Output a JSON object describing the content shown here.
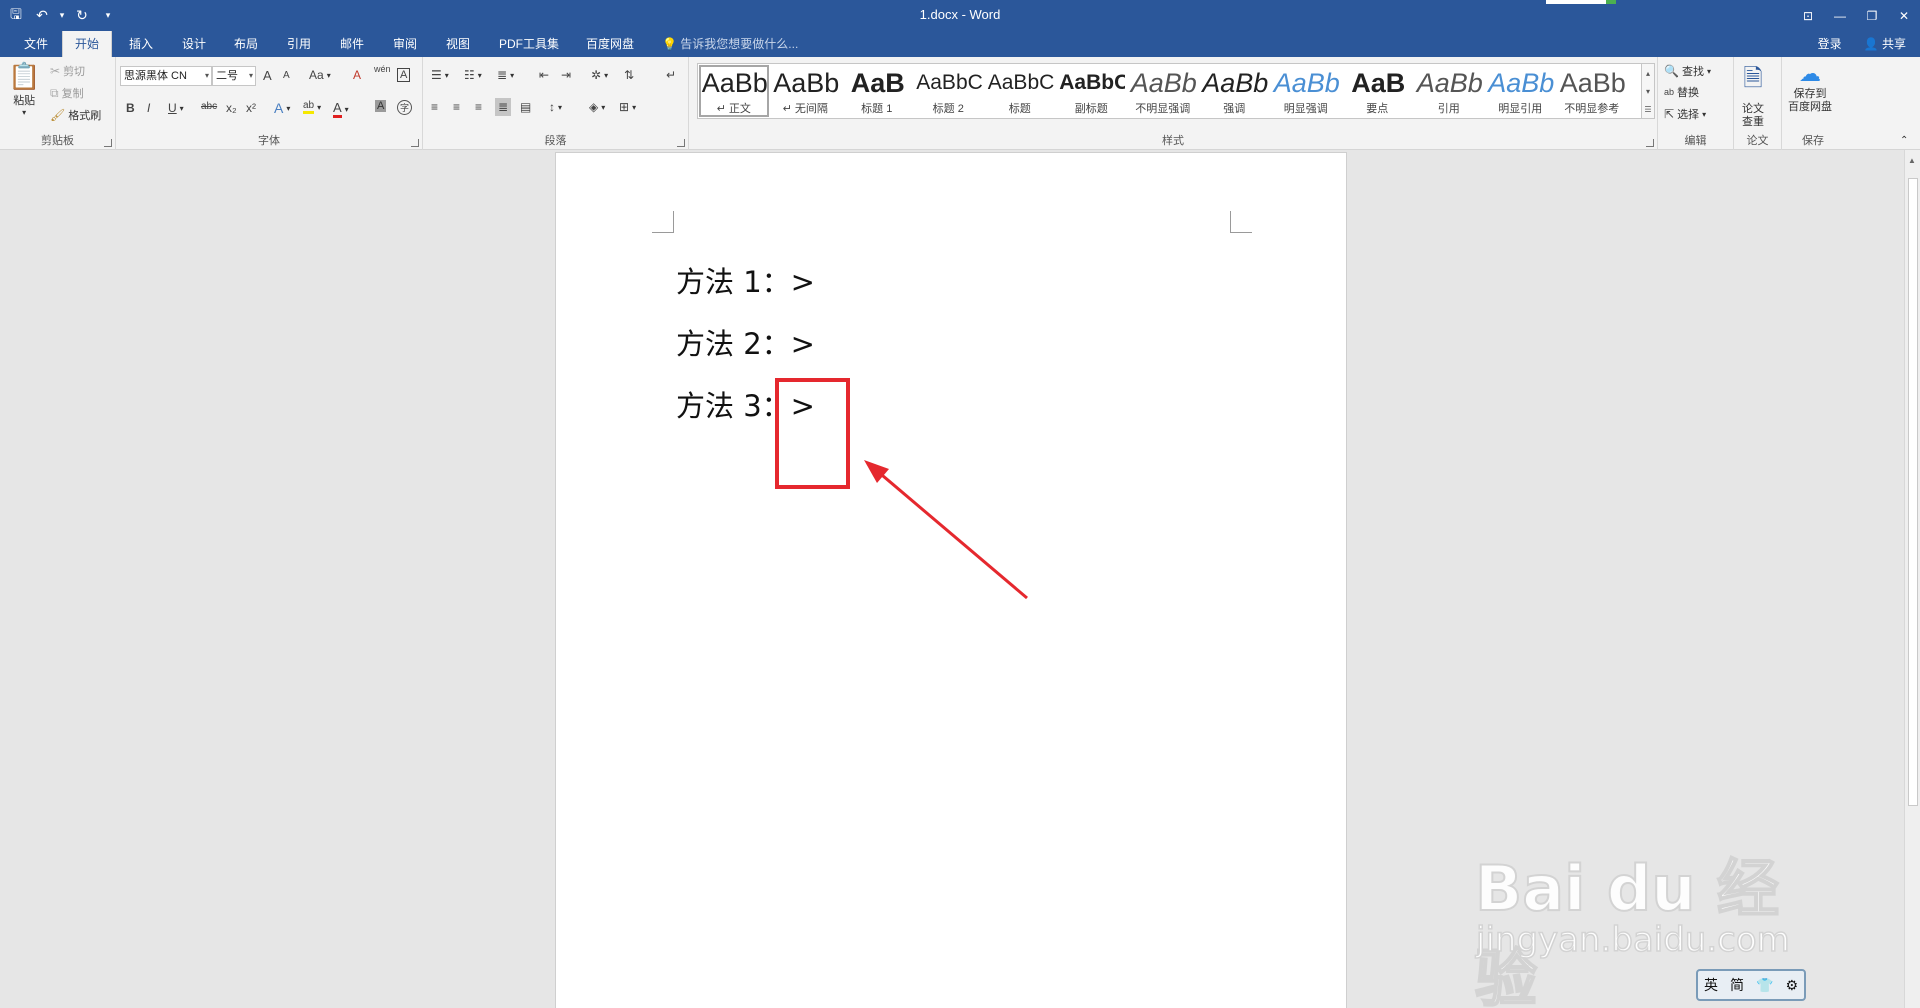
{
  "titlebar": {
    "title": "1.docx - Word",
    "qat": {
      "save": "🖫",
      "undo": "↶",
      "undo_dd": "▾",
      "redo": "↻",
      "customize": "▾"
    },
    "controls": {
      "ribbon_options": "⊡",
      "minimize": "—",
      "restore": "❐",
      "close": "✕"
    }
  },
  "tabs": [
    {
      "label": "文件"
    },
    {
      "label": "开始"
    },
    {
      "label": "插入"
    },
    {
      "label": "设计"
    },
    {
      "label": "布局"
    },
    {
      "label": "引用"
    },
    {
      "label": "邮件"
    },
    {
      "label": "审阅"
    },
    {
      "label": "视图"
    },
    {
      "label": "PDF工具集"
    },
    {
      "label": "百度网盘"
    }
  ],
  "tell_me": "告诉我您想要做什么...",
  "account": {
    "login": "登录",
    "share": "共享"
  },
  "clipboard": {
    "paste": "粘贴",
    "cut": "剪切",
    "copy": "复制",
    "format_painter": "格式刷",
    "group_label": "剪贴板"
  },
  "font": {
    "font_name": "思源黑体 CN",
    "font_size": "二号",
    "grow": "A",
    "shrink": "A",
    "case": "Aa",
    "clear": "A",
    "phonetic": "wén",
    "border_char": "A",
    "bold": "B",
    "italic": "I",
    "underline": "U",
    "strike": "abc",
    "subscript": "x₂",
    "superscript": "x²",
    "effects": "A",
    "highlight": "ab",
    "color": "A",
    "shading": "A",
    "enclose": "字",
    "group_label": "字体"
  },
  "paragraph": {
    "group_label": "段落"
  },
  "styles": {
    "group_label": "样式",
    "items": [
      {
        "sample": "AaBbCcDd",
        "name": "↵ 正文"
      },
      {
        "sample": "AaBbCcDd",
        "name": "↵ 无间隔"
      },
      {
        "sample": "AaB",
        "name": "标题 1"
      },
      {
        "sample": "AaBbC",
        "name": "标题 2"
      },
      {
        "sample": "AaBbC",
        "name": "标题"
      },
      {
        "sample": "AaBbC",
        "name": "副标题"
      },
      {
        "sample": "AaBbCcDd",
        "name": "不明显强调"
      },
      {
        "sample": "AaBbCcDd",
        "name": "强调"
      },
      {
        "sample": "AaBbCcDd",
        "name": "明显强调"
      },
      {
        "sample": "AaB",
        "name": "要点"
      },
      {
        "sample": "AaBbCcDd",
        "name": "引用"
      },
      {
        "sample": "AaBbCcDd",
        "name": "明显引用"
      },
      {
        "sample": "AaBbCcDd",
        "name": "不明显参考"
      }
    ]
  },
  "editing": {
    "find": "查找",
    "replace": "替换",
    "select": "选择",
    "group_label": "编辑"
  },
  "paper": {
    "check": "论文\n查重",
    "group_label": "论文"
  },
  "save_group": {
    "save_to": "保存到\n百度网盘",
    "group_label": "保存"
  },
  "document": {
    "lines": [
      {
        "text": "方法 1：>"
      },
      {
        "text": "方法 2：>"
      },
      {
        "text": "方法 3：>"
      }
    ]
  },
  "annotation_color": "#e5282e",
  "watermark": {
    "logo": "Bai du 经验",
    "url": "jingyan.baidu.com"
  },
  "ime": {
    "lang": "英",
    "mode": "简",
    "icon": "👕",
    "extra": "⚙"
  }
}
